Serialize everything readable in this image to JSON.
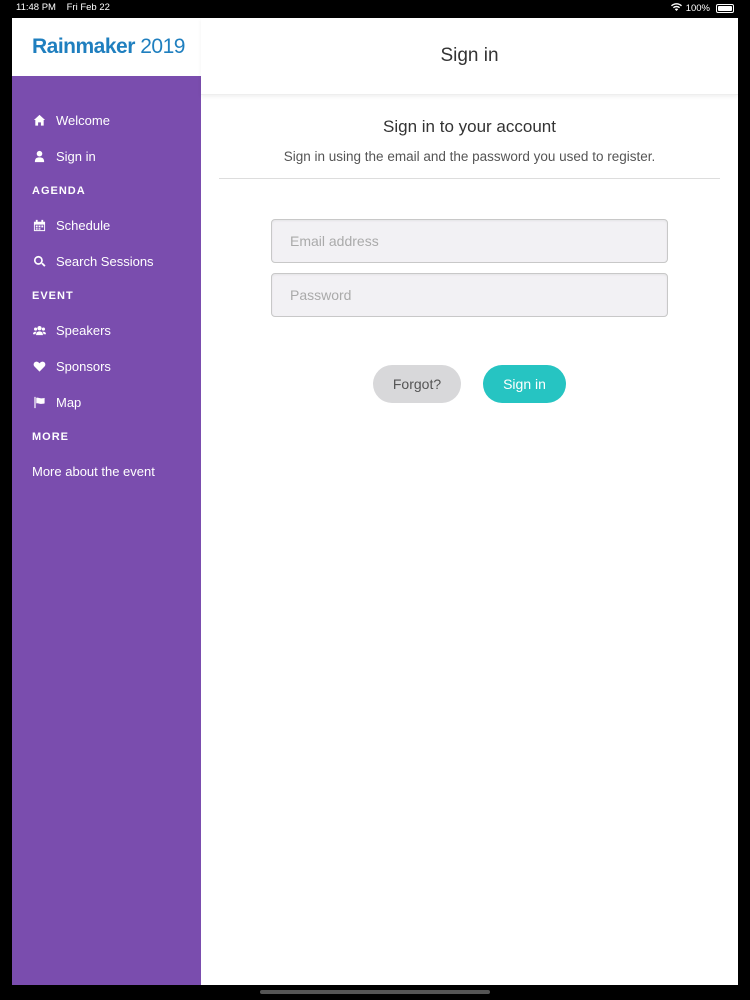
{
  "status_bar": {
    "time": "11:48 PM",
    "date": "Fri Feb 22",
    "battery": "100%"
  },
  "logo": {
    "bold": "Rainmaker",
    "year": "2019"
  },
  "sidebar": {
    "items": [
      {
        "label": "Welcome",
        "icon": "home-icon"
      },
      {
        "label": "Sign in",
        "icon": "user-icon"
      }
    ],
    "sections": {
      "agenda": {
        "title": "AGENDA",
        "items": [
          {
            "label": "Schedule",
            "icon": "calendar-icon"
          },
          {
            "label": "Search Sessions",
            "icon": "search-icon"
          }
        ]
      },
      "event": {
        "title": "EVENT",
        "items": [
          {
            "label": "Speakers",
            "icon": "users-icon"
          },
          {
            "label": "Sponsors",
            "icon": "heart-icon"
          },
          {
            "label": "Map",
            "icon": "flag-icon"
          }
        ]
      },
      "more": {
        "title": "MORE",
        "items": [
          {
            "label": "More about the event"
          }
        ]
      }
    }
  },
  "header": {
    "title": "Sign in"
  },
  "main": {
    "title": "Sign in to your account",
    "subtitle": "Sign in using the email and the password you used to register.",
    "email": {
      "value": "",
      "placeholder": "Email address"
    },
    "password": {
      "value": "",
      "placeholder": "Password"
    },
    "forgot_label": "Forgot?",
    "signin_label": "Sign in"
  },
  "colors": {
    "sidebar": "#7a4dae",
    "logo": "#1f7fbf",
    "signin_button": "#26c4c2",
    "forgot_button": "#d8d8da"
  }
}
